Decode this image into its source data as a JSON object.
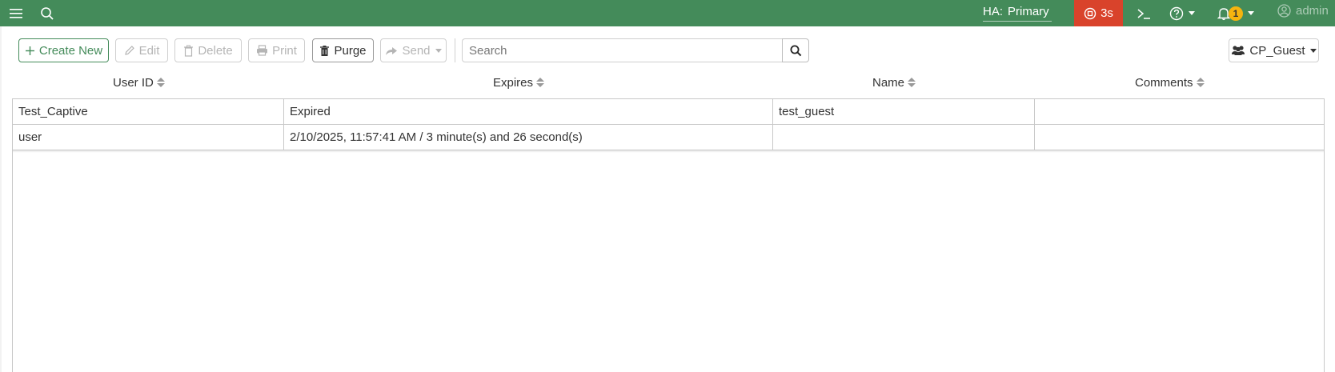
{
  "topbar": {
    "ha_label": "HA:",
    "ha_value": "Primary",
    "timer": "3s",
    "notification_count": "1",
    "user": "admin",
    "bg_color": "#448b5a",
    "timer_color": "#d9432b"
  },
  "toolbar": {
    "create_new": "Create New",
    "edit": "Edit",
    "delete": "Delete",
    "print": "Print",
    "purge": "Purge",
    "send": "Send",
    "search_placeholder": "Search",
    "group": "CP_Guest"
  },
  "table": {
    "columns": [
      "User ID",
      "Expires",
      "Name",
      "Comments"
    ],
    "rows": [
      [
        "Test_Captive",
        "Expired",
        "test_guest",
        ""
      ],
      [
        "user",
        "2/10/2025, 11:57:41 AM / 3 minute(s) and 26 second(s)",
        "",
        ""
      ]
    ]
  }
}
